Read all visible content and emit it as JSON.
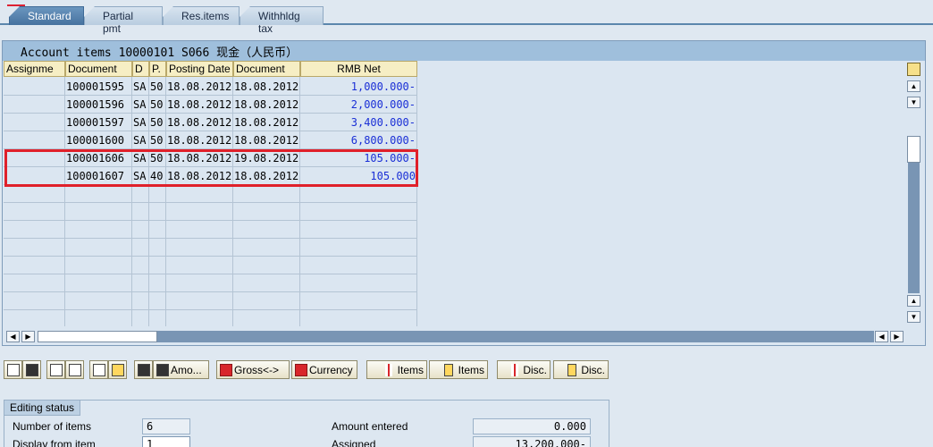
{
  "tabs": [
    {
      "label": "Standard",
      "active": true
    },
    {
      "label": "Partial pmt",
      "active": false
    },
    {
      "label": "Res.items",
      "active": false
    },
    {
      "label": "Withhldg tax",
      "active": false
    }
  ],
  "panel": {
    "title": "Account items 10000101 S066 现金（人民币）"
  },
  "table": {
    "headers": [
      "Assignme",
      "Document",
      "D",
      "P.",
      "Posting Date",
      "Document",
      "RMB Net"
    ],
    "rows": [
      {
        "assignment": "",
        "document": "100001595",
        "d": "SA",
        "p": "50",
        "posting_date": "18.08.2012",
        "doc_date": "18.08.2012",
        "net": "1,000.000-"
      },
      {
        "assignment": "",
        "document": "100001596",
        "d": "SA",
        "p": "50",
        "posting_date": "18.08.2012",
        "doc_date": "18.08.2012",
        "net": "2,000.000-"
      },
      {
        "assignment": "",
        "document": "100001597",
        "d": "SA",
        "p": "50",
        "posting_date": "18.08.2012",
        "doc_date": "18.08.2012",
        "net": "3,400.000-"
      },
      {
        "assignment": "",
        "document": "100001600",
        "d": "SA",
        "p": "50",
        "posting_date": "18.08.2012",
        "doc_date": "18.08.2012",
        "net": "6,800.000-"
      },
      {
        "assignment": "",
        "document": "100001606",
        "d": "SA",
        "p": "50",
        "posting_date": "18.08.2012",
        "doc_date": "19.08.2012",
        "net": "105.000-"
      },
      {
        "assignment": "",
        "document": "100001607",
        "d": "SA",
        "p": "40",
        "posting_date": "18.08.2012",
        "doc_date": "18.08.2012",
        "net": "105.000"
      }
    ]
  },
  "toolbar": {
    "amount_label": "Amo...",
    "gross_label": "Gross<->",
    "currency_label": "Currency",
    "items_label": "Items",
    "items2_label": "Items",
    "disc_label": "Disc.",
    "disc2_label": "Disc."
  },
  "editing_status": {
    "title": "Editing status",
    "number_of_items_label": "Number of items",
    "number_of_items": "6",
    "display_from_label": "Display from item",
    "display_from": "1",
    "amount_entered_label": "Amount entered",
    "amount_entered": "0.000",
    "assigned_label": "Assigned",
    "assigned": "13,200.000-"
  },
  "colors": {
    "accent": "#46729f",
    "amount_text": "#1a2fd6",
    "highlight_box": "#e0202a",
    "header_bg": "#f6eec4"
  }
}
